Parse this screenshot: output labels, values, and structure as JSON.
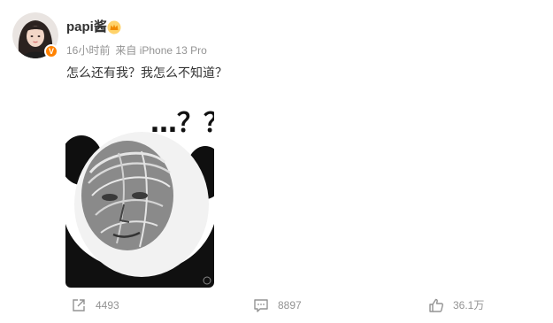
{
  "post": {
    "author": {
      "name": "papi酱",
      "avatar_icon": "avatar-photo",
      "verified_badge_icon": "verified-v-icon",
      "vip_icon": "crown-icon"
    },
    "meta": {
      "time": "16小时前",
      "source": "来自 iPhone 13 Pro"
    },
    "text": "怎么还有我？我怎么不知道？",
    "image": {
      "icon": "panda-meme-image",
      "caption_text": "…？？"
    },
    "actions": {
      "share": {
        "icon": "share-icon",
        "count": "4493"
      },
      "comment": {
        "icon": "comment-icon",
        "count": "8897"
      },
      "like": {
        "icon": "thumbs-up-icon",
        "count": "36.1万"
      }
    }
  },
  "colors": {
    "text": "#333333",
    "muted": "#939393",
    "badge": "#ff8200",
    "vip": "#f5a623"
  }
}
